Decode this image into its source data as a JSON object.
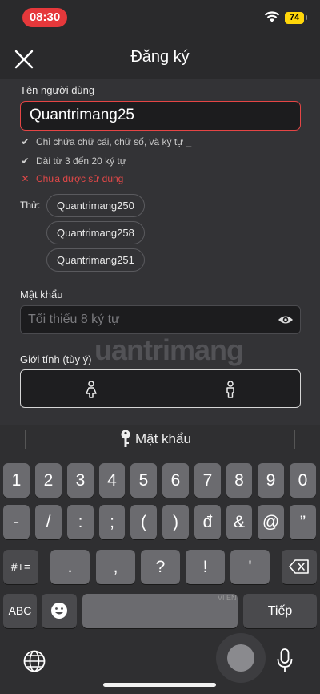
{
  "status": {
    "time": "08:30",
    "battery": "74"
  },
  "header": {
    "title": "Đăng ký"
  },
  "form": {
    "username_label": "Tên người dùng",
    "username_value": "Quantrimang25",
    "rules": [
      "Chỉ chứa chữ cái, chữ số, và ký tự _",
      "Dài từ 3 đến 20 ký tự",
      "Chưa được sử dụng"
    ],
    "try_label": "Thử:",
    "suggestions": [
      "Quantrimang250",
      "Quantrimang258",
      "Quantrimang251"
    ],
    "password_label": "Mật khẩu",
    "password_placeholder": "Tối thiểu 8 ký tự",
    "gender_label": "Giới tính (tùy ý)",
    "watermark": "uantrimang"
  },
  "keyboard": {
    "suggestion": "Mật khẩu",
    "row1": [
      "1",
      "2",
      "3",
      "4",
      "5",
      "6",
      "7",
      "8",
      "9",
      "0"
    ],
    "row2": [
      "-",
      "/",
      ":",
      ";",
      "(",
      ")",
      "đ",
      "&",
      "@",
      "”"
    ],
    "row3_switch": "#+=",
    "row3": [
      ".",
      ",",
      "?",
      "!",
      "'"
    ],
    "abc": "ABC",
    "space_lang": "VI EN",
    "return": "Tiếp"
  },
  "colors": {
    "accent_error": "#e54545",
    "status_pill": "#e5383b",
    "battery": "#ffd60a"
  }
}
